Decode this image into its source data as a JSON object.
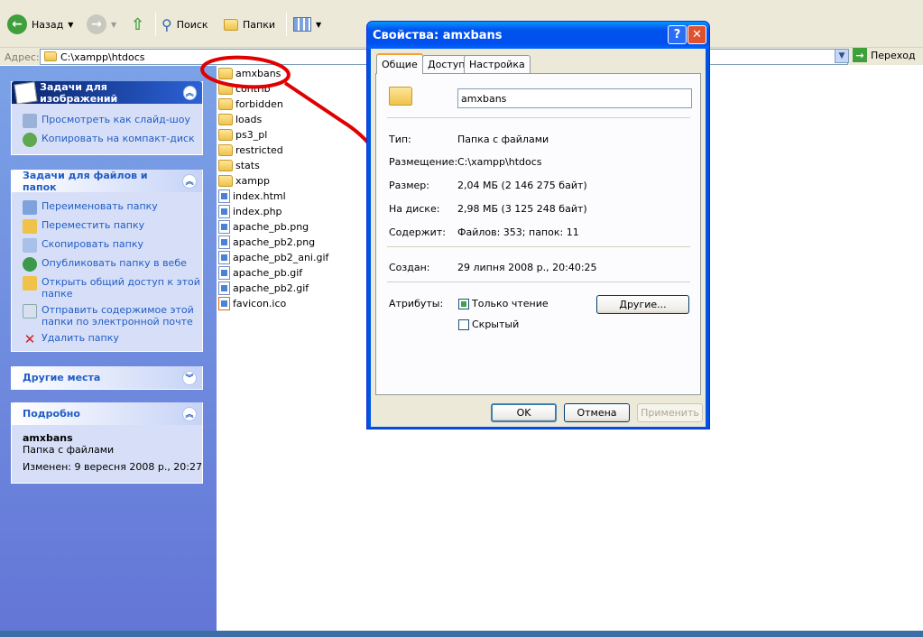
{
  "toolbar": {
    "back_label": "Назад",
    "search_label": "Поиск",
    "folders_label": "Папки"
  },
  "address": {
    "label": "Адрес:",
    "value": "C:\\xampp\\htdocs",
    "go_label": "Переход"
  },
  "image_tasks": {
    "title": "Задачи для изображений",
    "items": [
      "Просмотреть как слайд-шоу",
      "Копировать на компакт-диск"
    ]
  },
  "file_tasks": {
    "title": "Задачи для файлов и папок",
    "items": [
      "Переименовать папку",
      "Переместить папку",
      "Скопировать папку",
      "Опубликовать папку в вебе",
      "Открыть общий доступ к этой папке",
      "Отправить содержимое этой папки по электронной почте",
      "Удалить папку"
    ]
  },
  "other_places": {
    "title": "Другие места"
  },
  "details": {
    "title": "Подробно",
    "name": "amxbans",
    "type": "Папка с файлами",
    "modified": "Изменен: 9 вересня 2008 р., 20:27"
  },
  "files": [
    {
      "name": "amxbans",
      "kind": "folder"
    },
    {
      "name": "contrib",
      "kind": "folder"
    },
    {
      "name": "forbidden",
      "kind": "folder"
    },
    {
      "name": "loads",
      "kind": "folder"
    },
    {
      "name": "ps3_pl",
      "kind": "folder"
    },
    {
      "name": "restricted",
      "kind": "folder"
    },
    {
      "name": "stats",
      "kind": "folder"
    },
    {
      "name": "xampp",
      "kind": "folder"
    },
    {
      "name": "index.html",
      "kind": "html"
    },
    {
      "name": "index.php",
      "kind": "php"
    },
    {
      "name": "apache_pb.png",
      "kind": "image"
    },
    {
      "name": "apache_pb2.png",
      "kind": "image"
    },
    {
      "name": "apache_pb2_ani.gif",
      "kind": "image"
    },
    {
      "name": "apache_pb.gif",
      "kind": "image"
    },
    {
      "name": "apache_pb2.gif",
      "kind": "image"
    },
    {
      "name": "favicon.ico",
      "kind": "icon"
    }
  ],
  "dialog": {
    "title": "Свойства: amxbans",
    "tabs": [
      "Общие",
      "Доступ",
      "Настройка"
    ],
    "name_value": "amxbans",
    "type_label": "Тип:",
    "type_value": "Папка с файлами",
    "location_label": "Размещение:",
    "location_value": "C:\\xampp\\htdocs",
    "size_label": "Размер:",
    "size_value": "2,04 МБ (2 146 275 байт)",
    "disk_label": "На диске:",
    "disk_value": "2,98 МБ (3 125 248 байт)",
    "contains_label": "Содержит:",
    "contains_value": "Файлов: 353; папок: 11",
    "created_label": "Создан:",
    "created_value": "29 липня 2008 р., 20:40:25",
    "attributes_label": "Атрибуты:",
    "readonly_label": "Только чтение",
    "readonly_checked": true,
    "hidden_label": "Скрытый",
    "hidden_checked": false,
    "other_button": "Другие...",
    "ok_button": "OK",
    "cancel_button": "Отмена",
    "apply_button": "Применить"
  },
  "colors": {
    "annotation": "#e00000",
    "xp_title": "#0054e3",
    "task_link": "#215dc6"
  }
}
